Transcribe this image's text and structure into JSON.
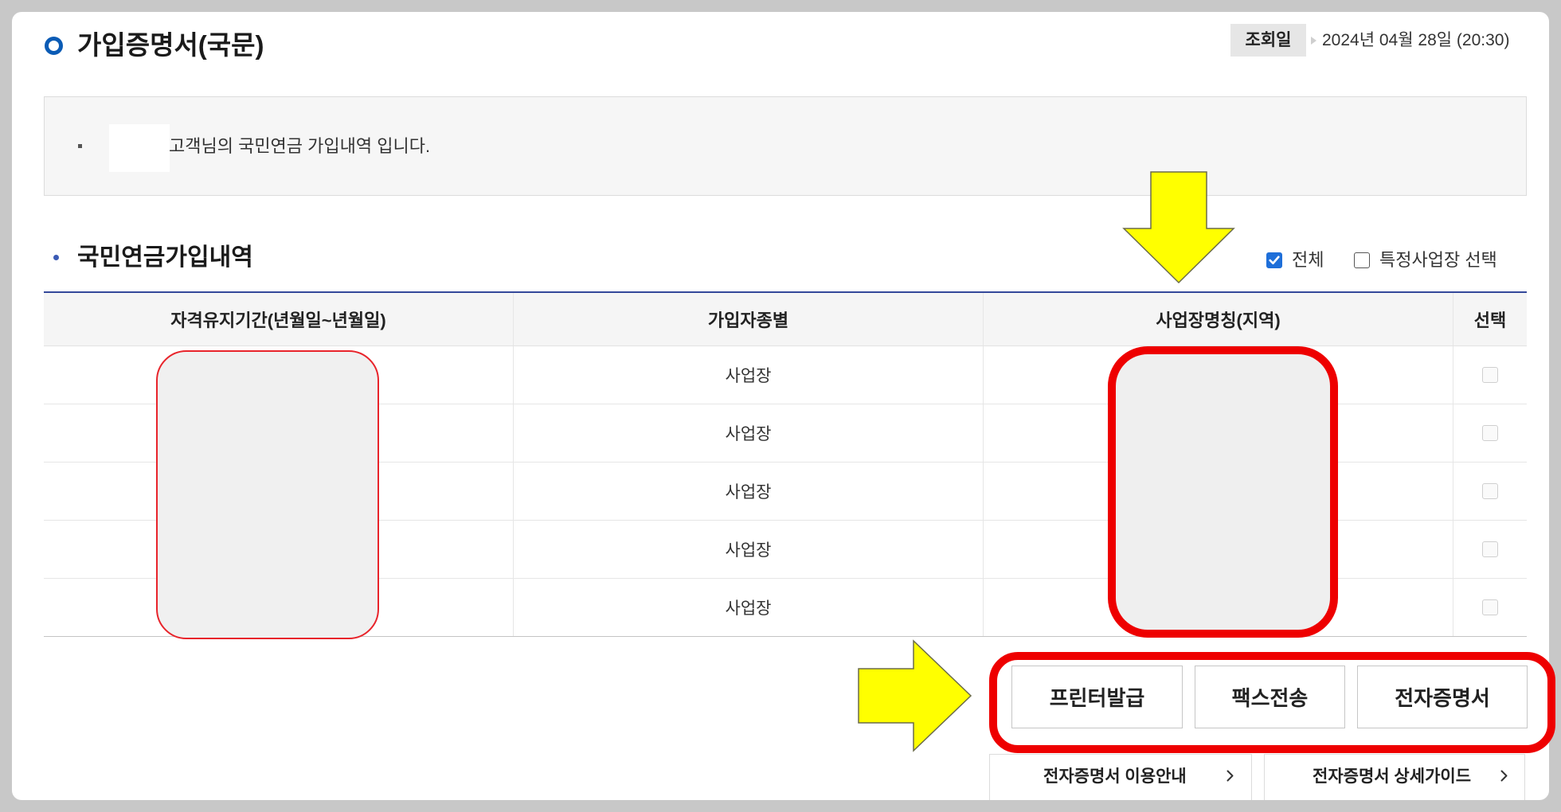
{
  "header": {
    "title": "가입증명서(국문)",
    "inquiry_label": "조회일",
    "inquiry_date": "2024년 04월 28일 (20:30)"
  },
  "notice": {
    "text": "고객님의 국민연금 가입내역 입니다."
  },
  "section": {
    "title": "국민연금가입내역"
  },
  "filters": [
    {
      "label": "전체",
      "checked": true
    },
    {
      "label": "특정사업장 선택",
      "checked": false
    }
  ],
  "table": {
    "columns": [
      "자격유지기간(년월일~년월일)",
      "가입자종별",
      "사업장명칭(지역)",
      "선택"
    ],
    "rows": [
      {
        "member_type": "사업장",
        "selected": false
      },
      {
        "member_type": "사업장",
        "selected": false
      },
      {
        "member_type": "사업장",
        "selected": false
      },
      {
        "member_type": "사업장",
        "selected": false
      },
      {
        "member_type": "사업장",
        "selected": false
      }
    ]
  },
  "actions": [
    {
      "label": "프린터발급"
    },
    {
      "label": "팩스전송"
    },
    {
      "label": "전자증명서"
    }
  ],
  "links": [
    {
      "label": "전자증명서 이용안내"
    },
    {
      "label": "전자증명서 상세가이드"
    }
  ],
  "icons": {
    "title_marker": "ring-icon",
    "section_marker": "dot-icon",
    "notice_bullet": "bullet-icon",
    "date_separator": "triangle-right-icon",
    "checkbox_checked": "checkmark-icon",
    "link_chevron": "chevron-right-icon",
    "annotation_down": "arrow-down-icon",
    "annotation_right": "arrow-right-icon"
  },
  "colors": {
    "marker_blue": "#0a5bb5",
    "checkbox_blue": "#1e6fd9",
    "table_top_border": "#34489a",
    "highlight_red": "#ee0000",
    "annotation_yellow": "#ffff00"
  }
}
